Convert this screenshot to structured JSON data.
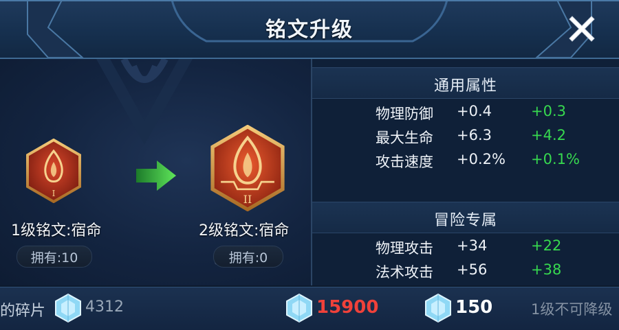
{
  "window": {
    "title": "铭文升级"
  },
  "icons": {
    "close": "close-icon",
    "gem": "crystal-gem-icon",
    "arrow": "green-arrow-right-icon"
  },
  "current_rune": {
    "name": "1级铭文:宿命",
    "owned": "拥有:10",
    "numeral": "I"
  },
  "next_rune": {
    "name": "2级铭文:宿命",
    "owned": "拥有:0",
    "numeral": "II"
  },
  "general_attributes": {
    "title": "通用属性",
    "rows": [
      {
        "label": "物理防御",
        "base": "+0.4",
        "gain": "+0.3"
      },
      {
        "label": "最大生命",
        "base": "+6.3",
        "gain": "+4.2"
      },
      {
        "label": "攻击速度",
        "base": "+0.2%",
        "gain": "+0.1%"
      }
    ]
  },
  "adventure_attributes": {
    "title": "冒险专属",
    "rows": [
      {
        "label": "物理攻击",
        "base": "+34",
        "gain": "+22"
      },
      {
        "label": "法术攻击",
        "base": "+56",
        "gain": "+38"
      }
    ]
  },
  "bottom": {
    "fragments_label": "的碎片",
    "fragments_value": "4312",
    "cost_value": "15900",
    "cost2_value": "150",
    "note": "1级不可降级"
  },
  "colors": {
    "gain_green": "#37d94f",
    "cost_red": "#f0413a",
    "panel_bg": "#0f2038",
    "title_bar": "#1f3a5c"
  }
}
